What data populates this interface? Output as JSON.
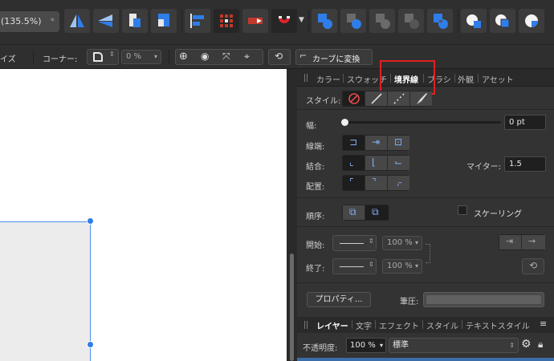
{
  "document": {
    "zoom_label": "(135.5%)",
    "modified_mark": "*"
  },
  "contextbar": {
    "prefix": "イズ",
    "corner_label": "コーナー:",
    "corner_value": "0 %",
    "convert_button": "カーブに変換"
  },
  "panel_tabs": [
    "カラー",
    "スウォッチ",
    "境界線",
    "ブラシ",
    "外観",
    "アセット"
  ],
  "active_tab": "境界線",
  "stroke": {
    "style_label": "スタイル:",
    "width_label": "幅:",
    "width_value": "0 pt",
    "cap_label": "線端:",
    "join_label": "結合:",
    "align_label": "配置:",
    "miter_label": "マイター:",
    "miter_value": "1.5",
    "order_label": "順序:",
    "scaling_label": "スケーリング",
    "start_label": "開始:",
    "end_label": "終了:",
    "start_scale": "100 %",
    "end_scale": "100 %",
    "properties_button": "プロパティ...",
    "pressure_label": "筆圧:"
  },
  "layers_tabs": [
    "レイヤー",
    "文字",
    "エフェクト",
    "スタイル",
    "テキストスタイル"
  ],
  "active_layers_tab": "レイヤー",
  "layers": {
    "opacity_label": "不透明度:",
    "opacity_value": "100 %",
    "blend_mode": "標準"
  },
  "colors": {
    "accent": "#2f7de9",
    "highlight": "#e0201f",
    "magnet": "#d9262c"
  }
}
